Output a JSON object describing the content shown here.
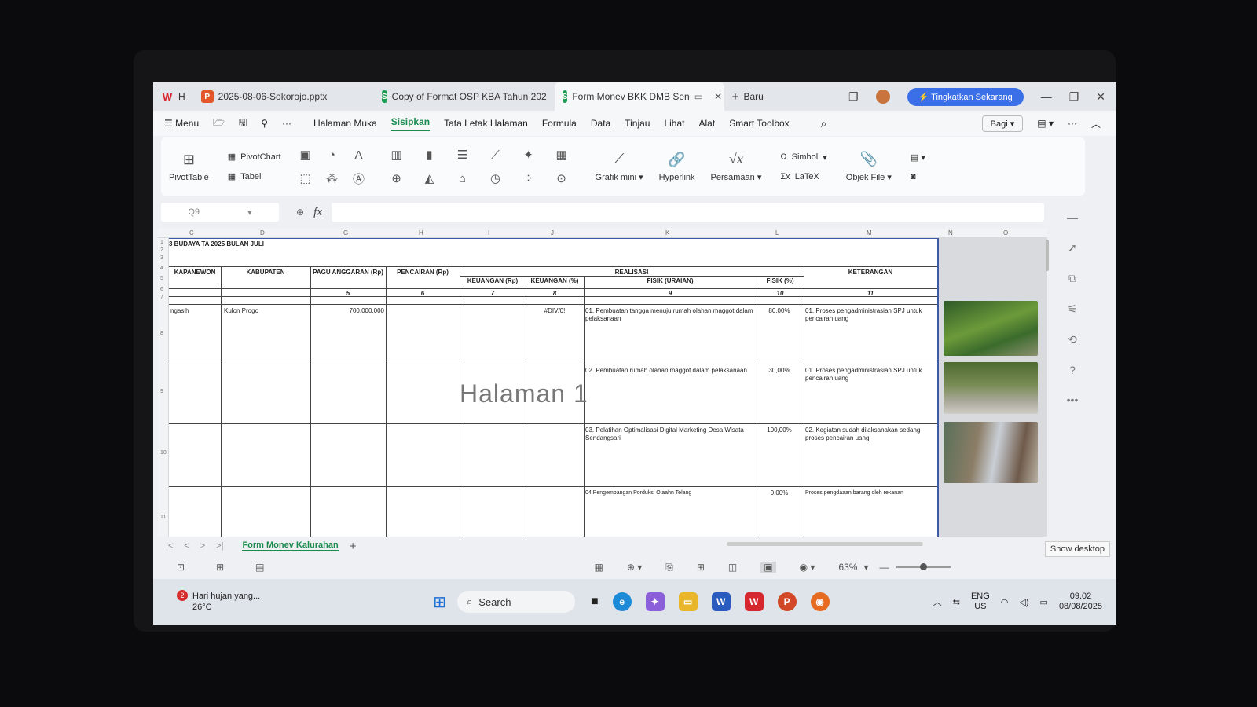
{
  "window": {
    "tabs": [
      {
        "label": "H",
        "app": "wps"
      },
      {
        "label": "2025-08-06-Sokorojo.pptx",
        "app": "presentation"
      },
      {
        "label": "Copy of Format OSP KBA Tahun 202",
        "app": "spreadsheet"
      },
      {
        "label": "Form Monev BKK DMB Sen",
        "app": "spreadsheet"
      }
    ],
    "new_tab_label": "Baru",
    "upgrade_label": "Tingkatkan Sekarang"
  },
  "menubar": {
    "menu_label": "Menu",
    "items": [
      "Halaman Muka",
      "Sisipkan",
      "Tata Letak Halaman",
      "Formula",
      "Data",
      "Tinjau",
      "Lihat",
      "Alat",
      "Smart Toolbox"
    ],
    "active": "Sisipkan",
    "share_label": "Bagi"
  },
  "ribbon": {
    "pivot_table": "PivotTable",
    "pivot_chart": "PivotChart",
    "table": "Tabel",
    "mini_chart": "Grafik mini",
    "hyperlink": "Hyperlink",
    "equation": "Persamaan",
    "symbol": "Simbol",
    "latex": "LaTeX",
    "object_file": "Objek File"
  },
  "formula_bar": {
    "cell_ref": "Q9",
    "fx": "fx"
  },
  "sheet": {
    "col_letters": [
      "C",
      "D",
      "G",
      "H",
      "I",
      "J",
      "K",
      "L",
      "M",
      "N",
      "O"
    ],
    "row_numbers": [
      "1",
      "2",
      "3",
      "4",
      "5",
      "6",
      "7",
      "8",
      "9",
      "10",
      "11"
    ],
    "title": "3 BUDAYA TA 2025 BULAN JULI",
    "headers": {
      "kapanewon": "KAPANEWON",
      "kabupaten": "KABUPATEN",
      "pagu": "PAGU ANGGARAN (Rp)",
      "pencairan": "PENCAIRAN (Rp)",
      "realisasi": "REALISASI",
      "keuangan_rp": "KEUANGAN (Rp)",
      "keuangan_pct": "KEUANGAN (%)",
      "fisik_uraian": "FISIK (URAIAN)",
      "fisik_pct": "FISIK (%)",
      "keterangan": "KETERANGAN"
    },
    "col_numbers": [
      "5",
      "6",
      "7",
      "8",
      "9",
      "10",
      "11"
    ],
    "row8": {
      "kapanewon": "ngasih",
      "kabupaten": "Kulon Progo",
      "pagu": "700.000.000",
      "keu_pct": "#DIV/0!"
    },
    "rows": [
      {
        "uraian": "01. Pembuatan tangga menuju rumah olahan maggot dalam pelaksanaan",
        "fisik": "80,00%",
        "ket": "01. Proses pengadministrasian SPJ untuk pencairan uang"
      },
      {
        "uraian": "02. Pembuatan rumah olahan maggot dalam pelaksanaan",
        "fisik": "30,00%",
        "ket": "01. Proses pengadministrasian SPJ untuk pencairan uang"
      },
      {
        "uraian": "03. Pelatihan Optimalisasi Digital Marketing Desa Wisata Sendangsari",
        "fisik": "100,00%",
        "ket": "02. Kegiatan sudah dilaksanakan sedang proses pencairan uang"
      },
      {
        "uraian": "04 Pengembangan Porduksi Olaahn Telang",
        "fisik": "0,00%",
        "ket": "Proses pengdaaan barang oleh rekanan"
      }
    ],
    "watermark": "Halaman 1"
  },
  "sheet_tab": "Form Monev Kalurahan",
  "status": {
    "zoom": "63%",
    "show_desktop": "Show desktop"
  },
  "taskbar": {
    "weather_text": "Hari hujan yang...",
    "weather_temp": "26°C",
    "notification_count": "2",
    "search_placeholder": "Search",
    "lang_top": "ENG",
    "lang_bottom": "US",
    "time": "09.02",
    "date": "08/08/2025"
  }
}
